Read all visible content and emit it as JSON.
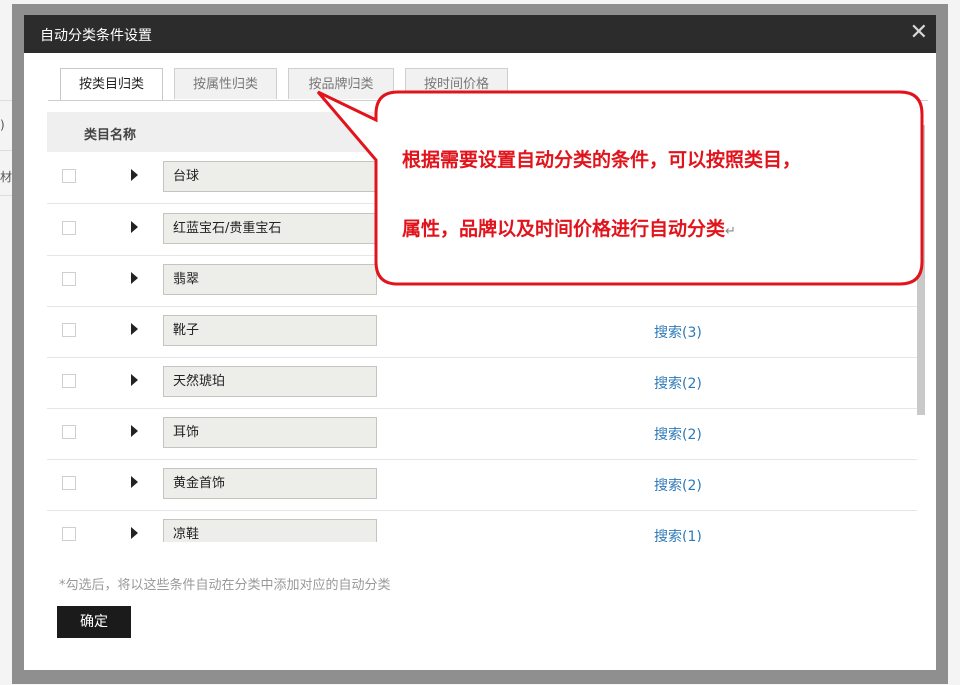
{
  "background": {
    "fragments": [
      ")",
      "材"
    ]
  },
  "dialog": {
    "title": "自动分类条件设置",
    "close_glyph": "✕",
    "tabs": [
      {
        "label": "按类目归类",
        "active": true
      },
      {
        "label": "按属性归类",
        "active": false
      },
      {
        "label": "按品牌归类",
        "active": false
      },
      {
        "label": "按时间价格",
        "active": false
      }
    ],
    "table": {
      "header": "类目名称",
      "rows": [
        {
          "name": "台球",
          "search": ""
        },
        {
          "name": "红蓝宝石/贵重宝石",
          "search": ""
        },
        {
          "name": "翡翠",
          "search": ""
        },
        {
          "name": "靴子",
          "search": "搜索(3)"
        },
        {
          "name": "天然琥珀",
          "search": "搜索(2)"
        },
        {
          "name": "耳饰",
          "search": "搜索(2)"
        },
        {
          "name": "黄金首饰",
          "search": "搜索(2)"
        },
        {
          "name": "凉鞋",
          "search": "搜索(1)"
        }
      ]
    },
    "note": "*勾选后，将以这些条件自动在分类中添加对应的自动分类",
    "confirm_label": "确定"
  },
  "callout": {
    "line1": "根据需要设置自动分类的条件，可以按照类目，",
    "line2": "属性，品牌以及时间价格进行自动分类",
    "return_mark": "↵",
    "border_color": "#e1141c",
    "text_color": "#e1141c"
  },
  "colors": {
    "titlebar": "#2c2c2c",
    "link": "#2e7ab8",
    "confirm_button": "#1b1b1b"
  }
}
